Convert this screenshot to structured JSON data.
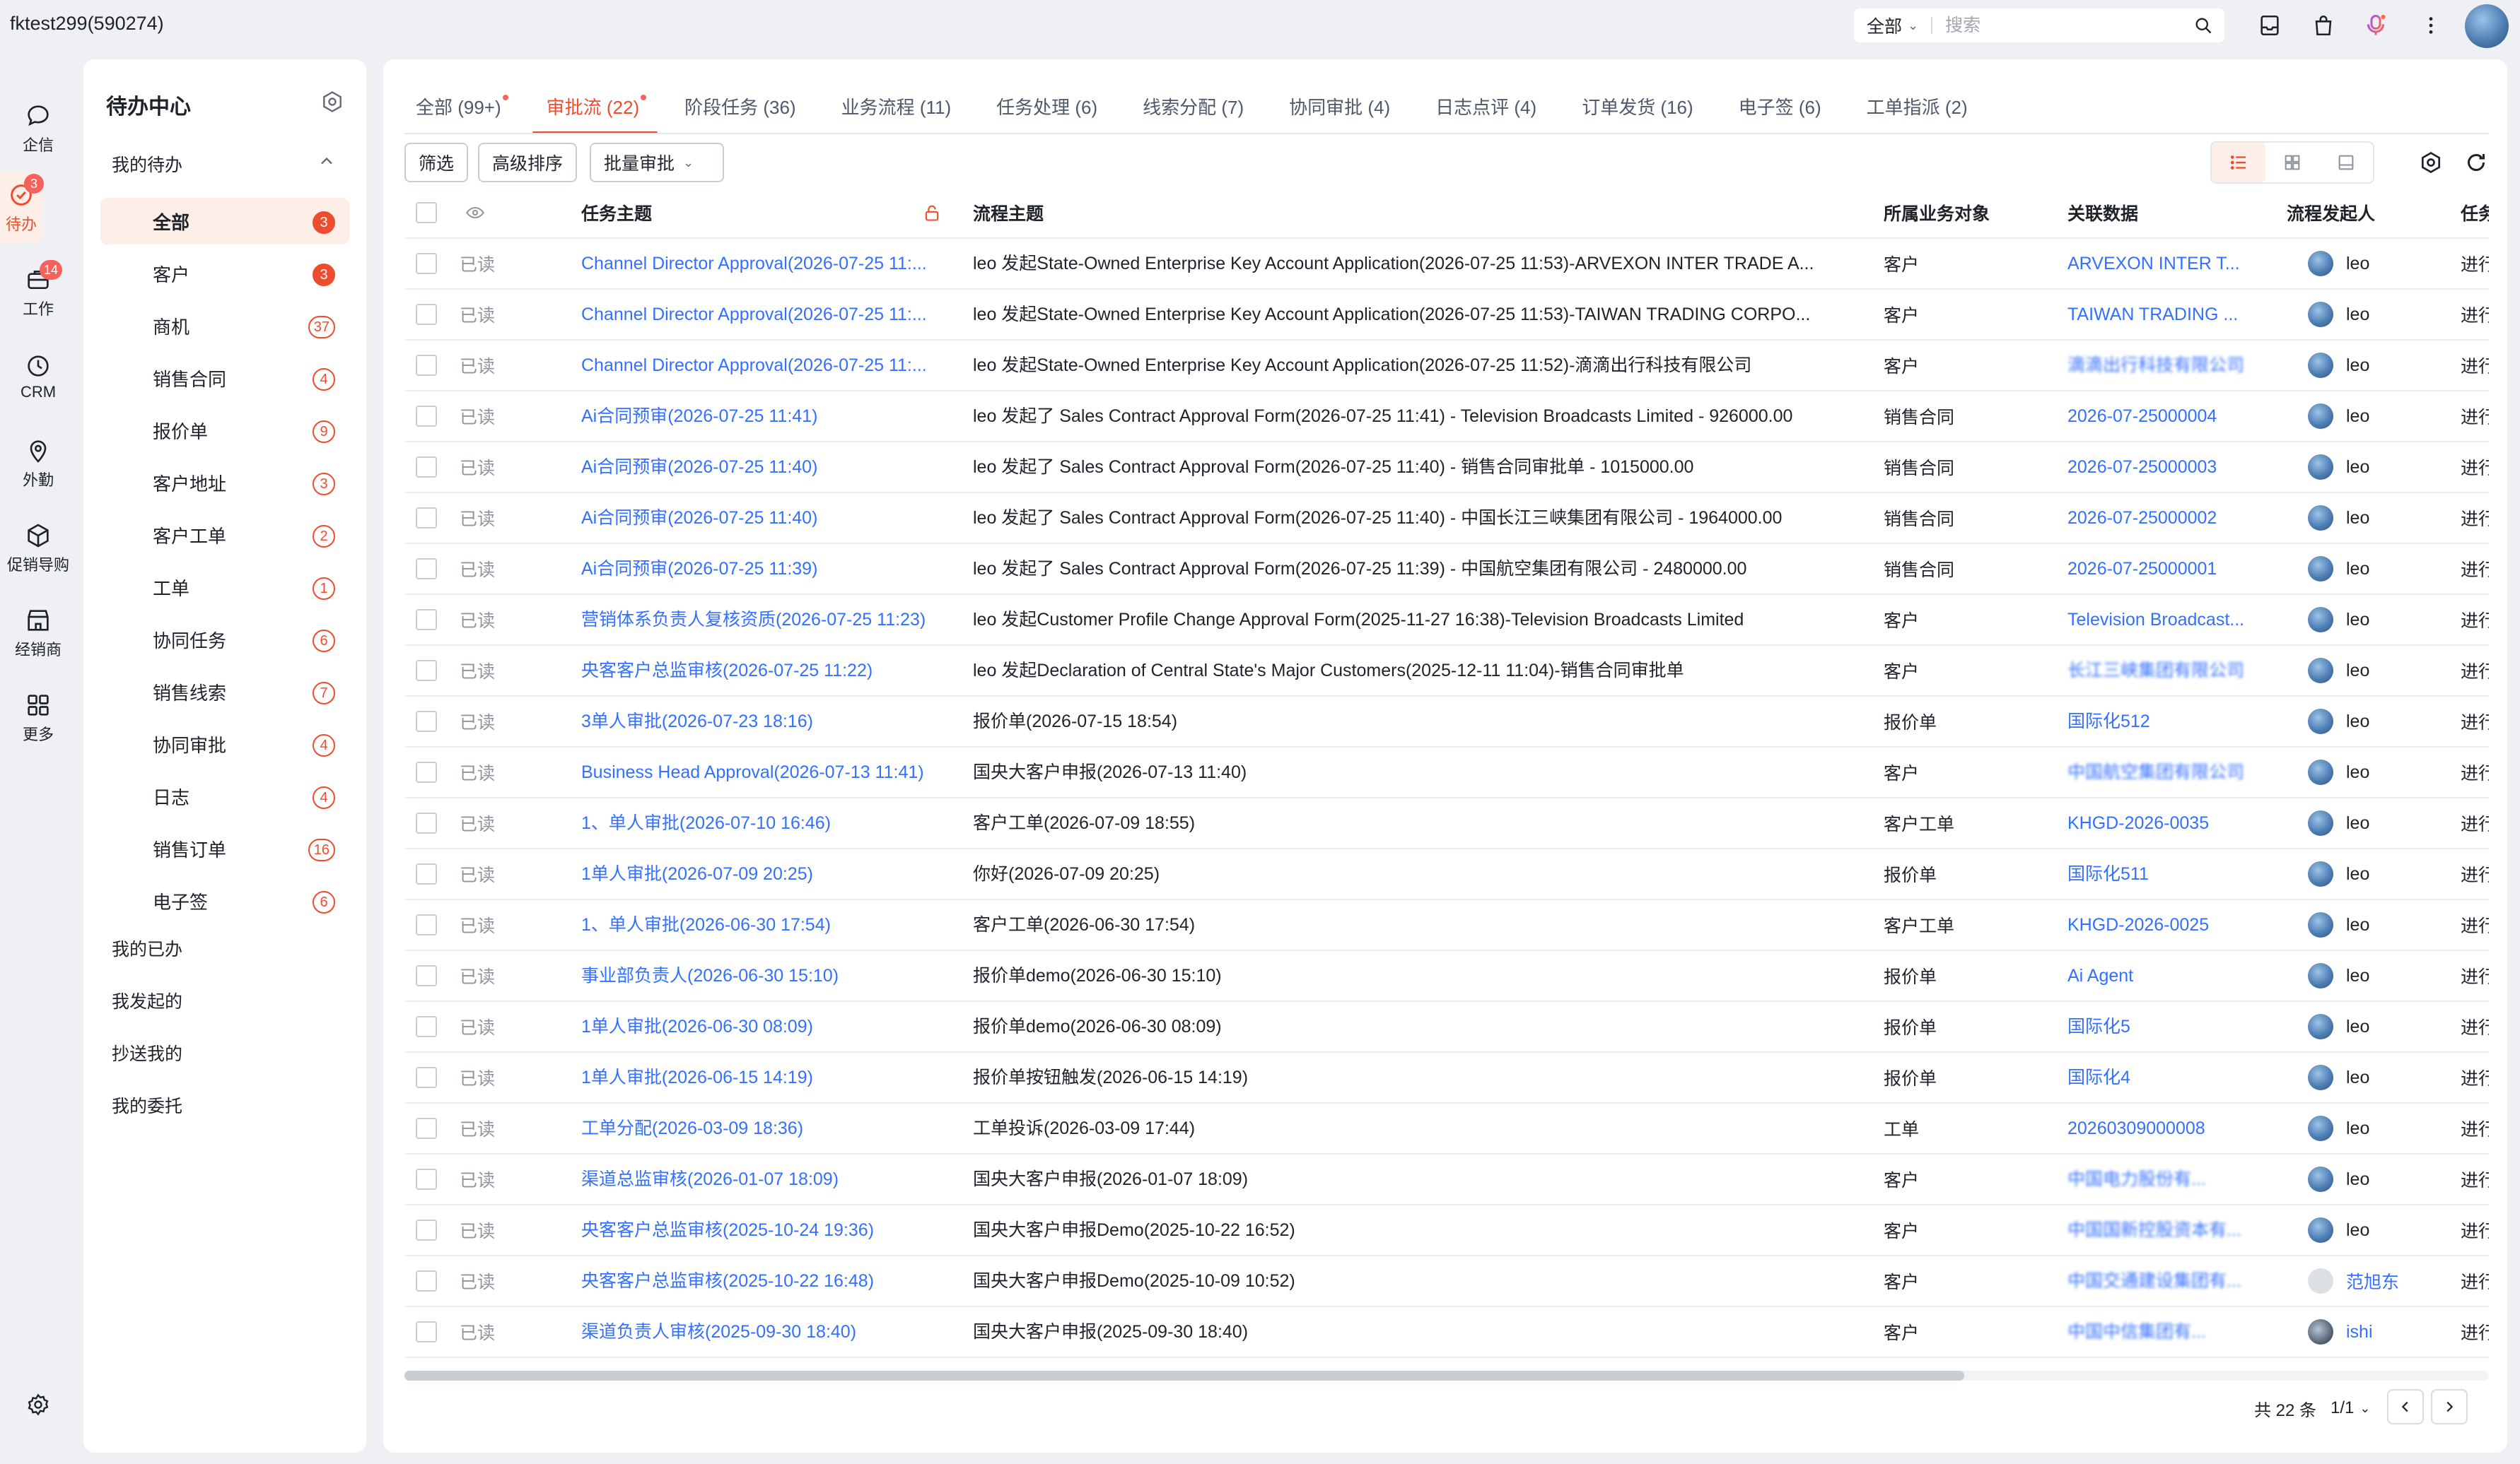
{
  "account": {
    "name": "fktest299(590274)"
  },
  "search": {
    "scope": "全部",
    "placeholder": "搜索"
  },
  "rail": [
    {
      "label": "企信",
      "icon": "chat-bubble-icon",
      "badge": ""
    },
    {
      "label": "待办",
      "icon": "todo-check-icon",
      "badge": "3"
    },
    {
      "label": "工作",
      "icon": "briefcase-icon",
      "badge": "14"
    },
    {
      "label": "CRM",
      "icon": "clock-icon",
      "badge": ""
    },
    {
      "label": "外勤",
      "icon": "location-pin-icon",
      "badge": ""
    },
    {
      "label": "促销导购",
      "icon": "cube-icon",
      "badge": ""
    },
    {
      "label": "经销商",
      "icon": "store-icon",
      "badge": ""
    },
    {
      "label": "更多",
      "icon": "grid-icon",
      "badge": ""
    }
  ],
  "menu": {
    "title": "待办中心",
    "group_label": "我的待办",
    "items": [
      {
        "label": "全部",
        "count": "3"
      },
      {
        "label": "客户",
        "count": "3"
      },
      {
        "label": "商机",
        "count": "37"
      },
      {
        "label": "销售合同",
        "count": "4"
      },
      {
        "label": "报价单",
        "count": "9"
      },
      {
        "label": "客户地址",
        "count": "3"
      },
      {
        "label": "客户工单",
        "count": "2"
      },
      {
        "label": "工单",
        "count": "1"
      },
      {
        "label": "协同任务",
        "count": "6"
      },
      {
        "label": "销售线索",
        "count": "7"
      },
      {
        "label": "协同审批",
        "count": "4"
      },
      {
        "label": "日志",
        "count": "4"
      },
      {
        "label": "销售订单",
        "count": "16"
      },
      {
        "label": "电子签",
        "count": "6"
      }
    ],
    "links": [
      "我的已办",
      "我发起的",
      "抄送我的",
      "我的委托"
    ]
  },
  "tabs": [
    {
      "label": "全部 (99+)",
      "dot": true
    },
    {
      "label": "审批流 (22)",
      "dot": true
    },
    {
      "label": "阶段任务 (36)",
      "dot": false
    },
    {
      "label": "业务流程 (11)",
      "dot": false
    },
    {
      "label": "任务处理 (6)",
      "dot": false
    },
    {
      "label": "线索分配 (7)",
      "dot": false
    },
    {
      "label": "协同审批 (4)",
      "dot": false
    },
    {
      "label": "日志点评 (4)",
      "dot": false
    },
    {
      "label": "订单发货 (16)",
      "dot": false
    },
    {
      "label": "电子签 (6)",
      "dot": false
    },
    {
      "label": "工单指派 (2)",
      "dot": false
    }
  ],
  "toolbar": {
    "filter": "筛选",
    "sort": "高级排序",
    "batch": "批量审批"
  },
  "table": {
    "headers": {
      "task": "任务主题",
      "flow": "流程主题",
      "object": "所属业务对象",
      "related": "关联数据",
      "initiator": "流程发起人",
      "status": "任务"
    },
    "rows": [
      {
        "read": "已读",
        "task": "Channel Director Approval(2026-07-25 11:...",
        "flow": "leo 发起State-Owned Enterprise Key Account Application(2026-07-25 11:53)-ARVEXON INTER TRADE A...",
        "object": "客户",
        "related": "ARVEXON INTER T...",
        "initiator": "leo",
        "status": "进行"
      },
      {
        "read": "已读",
        "task": "Channel Director Approval(2026-07-25 11:...",
        "flow": "leo 发起State-Owned Enterprise Key Account Application(2026-07-25 11:53)-TAIWAN TRADING CORPO...",
        "object": "客户",
        "related": "TAIWAN TRADING ...",
        "initiator": "leo",
        "status": "进行"
      },
      {
        "read": "已读",
        "task": "Channel Director Approval(2026-07-25 11:...",
        "flow": "leo 发起State-Owned Enterprise Key Account Application(2026-07-25 11:52)-滴滴出行科技有限公司",
        "object": "客户",
        "related": "滴滴出行科技有限公司",
        "initiator": "leo",
        "status": "进行"
      },
      {
        "read": "已读",
        "task": "Ai合同预审(2026-07-25 11:41)",
        "flow": "leo 发起了 Sales Contract Approval Form(2026-07-25 11:41) - Television Broadcasts Limited - 926000.00",
        "object": "销售合同",
        "related": "2026-07-25000004",
        "initiator": "leo",
        "status": "进行"
      },
      {
        "read": "已读",
        "task": "Ai合同预审(2026-07-25 11:40)",
        "flow": "leo 发起了 Sales Contract Approval Form(2026-07-25 11:40) - 销售合同审批单 - 1015000.00",
        "object": "销售合同",
        "related": "2026-07-25000003",
        "initiator": "leo",
        "status": "进行"
      },
      {
        "read": "已读",
        "task": "Ai合同预审(2026-07-25 11:40)",
        "flow": "leo 发起了 Sales Contract Approval Form(2026-07-25 11:40) - 中国长江三峡集团有限公司 - 1964000.00",
        "object": "销售合同",
        "related": "2026-07-25000002",
        "initiator": "leo",
        "status": "进行"
      },
      {
        "read": "已读",
        "task": "Ai合同预审(2026-07-25 11:39)",
        "flow": "leo 发起了 Sales Contract Approval Form(2026-07-25 11:39) - 中国航空集团有限公司 - 2480000.00",
        "object": "销售合同",
        "related": "2026-07-25000001",
        "initiator": "leo",
        "status": "进行"
      },
      {
        "read": "已读",
        "task": "营销体系负责人复核资质(2026-07-25 11:23)",
        "flow": "leo 发起Customer Profile Change Approval Form(2025-11-27 16:38)-Television Broadcasts Limited",
        "object": "客户",
        "related": "Television Broadcast...",
        "initiator": "leo",
        "status": "进行"
      },
      {
        "read": "已读",
        "task": "央客客户总监审核(2026-07-25 11:22)",
        "flow": "leo 发起Declaration of Central State's Major Customers(2025-12-11 11:04)-销售合同审批单",
        "object": "客户",
        "related": "长江三峡集团有限公司",
        "initiator": "leo",
        "status": "进行"
      },
      {
        "read": "已读",
        "task": "3单人审批(2026-07-23 18:16)",
        "flow": "报价单(2026-07-15 18:54)",
        "object": "报价单",
        "related": "国际化512",
        "initiator": "leo",
        "status": "进行"
      },
      {
        "read": "已读",
        "task": "Business Head Approval(2026-07-13 11:41)",
        "flow": "国央大客户申报(2026-07-13 11:40)",
        "object": "客户",
        "related": "中国航空集团有限公司",
        "initiator": "leo",
        "status": "进行"
      },
      {
        "read": "已读",
        "task": "1、单人审批(2026-07-10 16:46)",
        "flow": "客户工单(2026-07-09 18:55)",
        "object": "客户工单",
        "related": "KHGD-2026-0035",
        "initiator": "leo",
        "status": "进行"
      },
      {
        "read": "已读",
        "task": "1单人审批(2026-07-09 20:25)",
        "flow": "你好(2026-07-09 20:25)",
        "object": "报价单",
        "related": "国际化511",
        "initiator": "leo",
        "status": "进行"
      },
      {
        "read": "已读",
        "task": "1、单人审批(2026-06-30 17:54)",
        "flow": "客户工单(2026-06-30 17:54)",
        "object": "客户工单",
        "related": "KHGD-2026-0025",
        "initiator": "leo",
        "status": "进行"
      },
      {
        "read": "已读",
        "task": "事业部负责人(2026-06-30 15:10)",
        "flow": "报价单demo(2026-06-30 15:10)",
        "object": "报价单",
        "related": "Ai Agent",
        "initiator": "leo",
        "status": "进行"
      },
      {
        "read": "已读",
        "task": "1单人审批(2026-06-30 08:09)",
        "flow": "报价单demo(2026-06-30 08:09)",
        "object": "报价单",
        "related": "国际化5",
        "initiator": "leo",
        "status": "进行"
      },
      {
        "read": "已读",
        "task": "1单人审批(2026-06-15 14:19)",
        "flow": "报价单按钮触发(2026-06-15 14:19)",
        "object": "报价单",
        "related": "国际化4",
        "initiator": "leo",
        "status": "进行"
      },
      {
        "read": "已读",
        "task": "工单分配(2026-03-09 18:36)",
        "flow": "工单投诉(2026-03-09 17:44)",
        "object": "工单",
        "related": "20260309000008",
        "initiator": "leo",
        "status": "进行"
      },
      {
        "read": "已读",
        "task": "渠道总监审核(2026-01-07 18:09)",
        "flow": "国央大客户申报(2026-01-07 18:09)",
        "object": "客户",
        "related": "中国电力股份有...",
        "initiator": "leo",
        "status": "进行"
      },
      {
        "read": "已读",
        "task": "央客客户总监审核(2025-10-24 19:36)",
        "flow": "国央大客户申报Demo(2025-10-22 16:52)",
        "object": "客户",
        "related": "中国国新控股资本有...",
        "initiator": "leo",
        "status": "进行"
      },
      {
        "read": "已读",
        "task": "央客客户总监审核(2025-10-22 16:48)",
        "flow": "国央大客户申报Demo(2025-10-09 10:52)",
        "object": "客户",
        "related": "中国交通建设集团有...",
        "initiator": "范旭东",
        "status": "进行"
      },
      {
        "read": "已读",
        "task": "渠道负责人审核(2025-09-30 18:40)",
        "flow": "国央大客户申报(2025-09-30 18:40)",
        "object": "客户",
        "related": "中国中信集团有...",
        "initiator": "ishi",
        "status": "进行"
      }
    ]
  },
  "pager": {
    "total": "共 22 条",
    "page": "1/1"
  },
  "colors": {
    "accent": "#ee4d2d",
    "link": "#3370ff",
    "badge": "#f5615c"
  }
}
